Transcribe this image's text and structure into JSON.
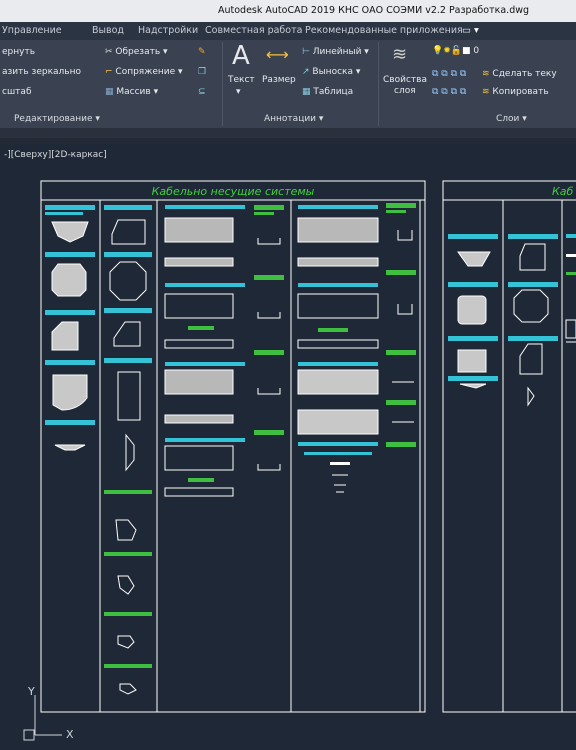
{
  "window": {
    "title": "Autodesk AutoCAD 2019   КНС ОАО СОЭМИ v2.2 Разработка.dwg"
  },
  "menu_tabs": [
    "Управление",
    "Вывод",
    "Надстройки",
    "Совместная работа",
    "Рекомендованные приложения"
  ],
  "ribbon": {
    "modify": {
      "left_items": [
        "ернуть",
        "азить зеркально",
        "сштаб"
      ],
      "trim": "Обрезать",
      "fillet": "Сопряжение",
      "array": "Массив",
      "panel_label": "Редактирование"
    },
    "annotations": {
      "text": "Текст",
      "dimension": "Размер",
      "linear": "Линейный",
      "leader": "Выноска",
      "table": "Таблица",
      "panel_label": "Аннотации"
    },
    "layers": {
      "properties_line1": "Свойства",
      "properties_line2": "слоя",
      "current_layer": "0",
      "make_current": "Сделать теку",
      "copy": "Копировать",
      "panel_label": "Слои"
    }
  },
  "viewport": {
    "label": "-][Сверху][2D-каркас]"
  },
  "drawing": {
    "sheet1_title": "Кабельно несущие системы",
    "sheet2_title": "Каб",
    "ucs_x": "X",
    "ucs_y": "Y"
  },
  "colors": {
    "background": "#1f2836",
    "title_green": "#3fd13f",
    "cyan": "#33c2d6",
    "green": "#3fbf3f",
    "white": "#ffffff",
    "gray_fill": "#c8c8c8"
  }
}
